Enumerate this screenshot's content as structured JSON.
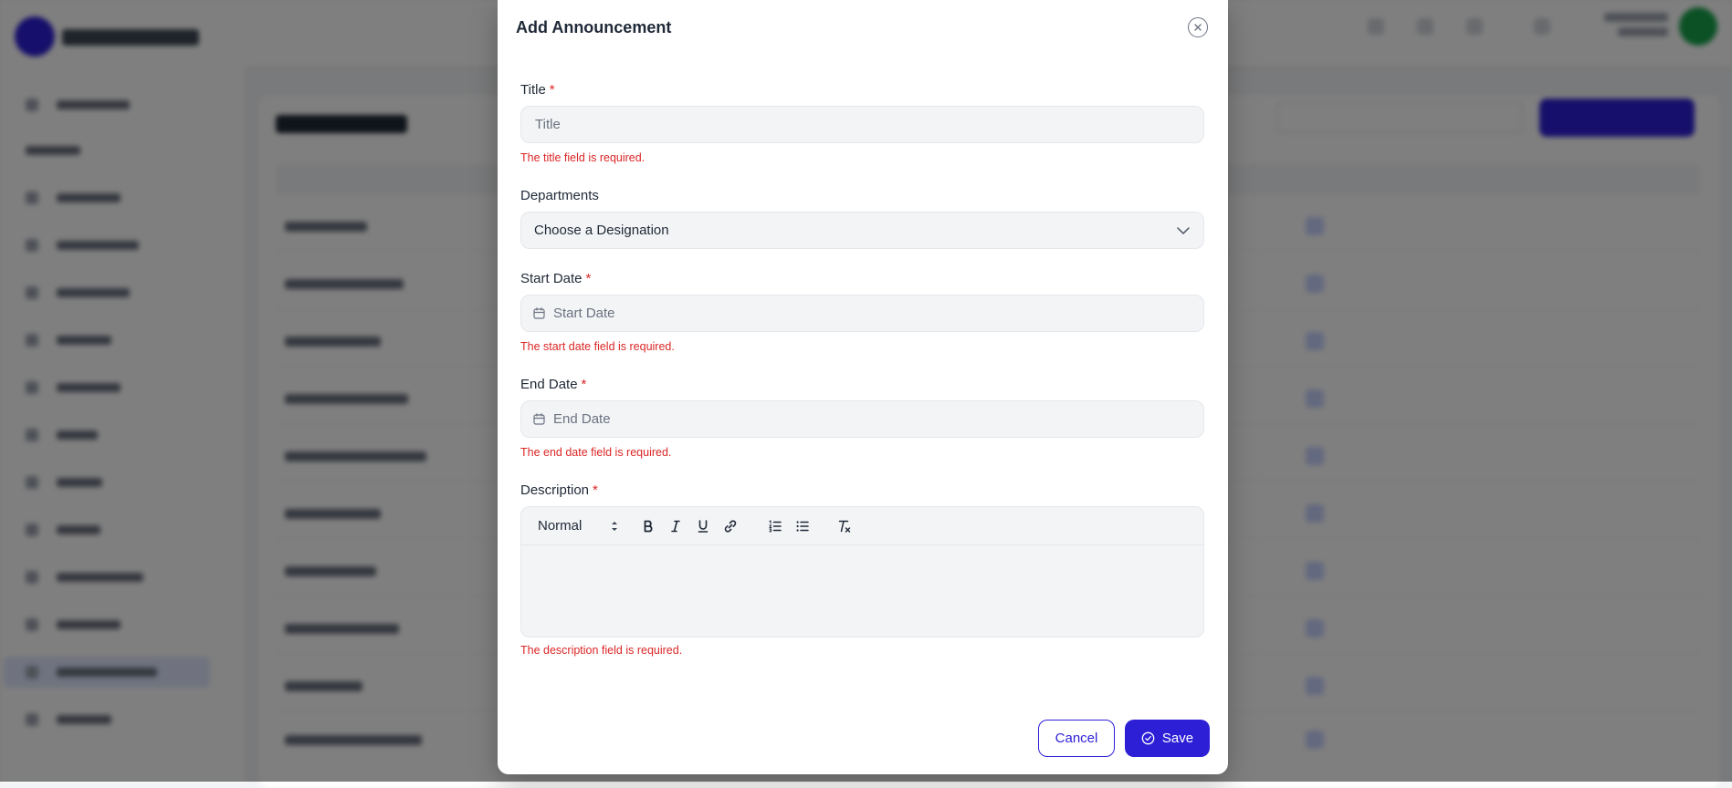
{
  "modal": {
    "title": "Add Announcement",
    "title_field": {
      "label": "Title",
      "required_mark": "*",
      "placeholder": "Title",
      "value": "",
      "error": "The title field is required."
    },
    "departments_field": {
      "label": "Departments",
      "selected": "Choose a Designation"
    },
    "start_date_field": {
      "label": "Start Date",
      "required_mark": "*",
      "placeholder": "Start Date",
      "value": "",
      "error": "The start date field is required."
    },
    "end_date_field": {
      "label": "End Date",
      "required_mark": "*",
      "placeholder": "End Date",
      "value": "",
      "error": "The end date field is required."
    },
    "description_field": {
      "label": "Description",
      "required_mark": "*",
      "toolbar": {
        "format_select": "Normal",
        "buttons": [
          "bold-icon",
          "italic-icon",
          "underline-icon",
          "link-icon",
          "ordered-list-icon",
          "bullet-list-icon",
          "clear-format-icon"
        ]
      },
      "value": "",
      "error": "The description field is required."
    },
    "cancel_label": "Cancel",
    "save_label": "Save"
  },
  "colors": {
    "primary": "#2d1fd6",
    "error": "#dc2626",
    "overlay": "rgba(0,0,0,0.5)",
    "input_bg": "#f3f4f6"
  }
}
